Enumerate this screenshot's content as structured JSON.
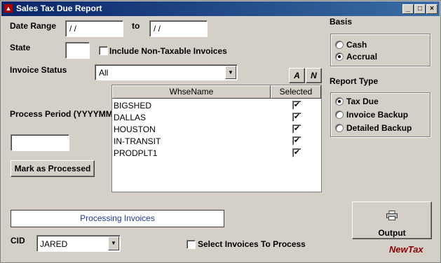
{
  "window": {
    "title": "Sales Tax Due Report",
    "icon": "report-app-icon"
  },
  "title_buttons": {
    "minimize": "_",
    "maximize": "□",
    "close": "×"
  },
  "filters": {
    "date_range_label": "Date Range",
    "date_from": "/ /",
    "to_label": "to",
    "date_to": "/ /",
    "state_label": "State",
    "state_value": "",
    "include_nontaxable_label": "Include Non-Taxable Invoices",
    "include_nontaxable_checked": false,
    "invoice_status_label": "Invoice Status",
    "invoice_status_value": "All"
  },
  "toolbar": {
    "all_button": "A",
    "none_button": "N"
  },
  "warehouse_grid": {
    "columns": [
      "WhseName",
      "Selected"
    ],
    "rows": [
      {
        "name": "BIGSHED",
        "selected": true
      },
      {
        "name": "DALLAS",
        "selected": true
      },
      {
        "name": "HOUSTON",
        "selected": true
      },
      {
        "name": "IN-TRANSIT",
        "selected": true
      },
      {
        "name": "PRODPLT1",
        "selected": true
      }
    ]
  },
  "process": {
    "period_label": "Process Period (YYYYMM)",
    "period_value": "",
    "mark_button": "Mark as Processed"
  },
  "status": {
    "text": "Processing Invoices"
  },
  "cid": {
    "label": "CID",
    "value": "JARED"
  },
  "select_invoices": {
    "label": "Select Invoices To Process",
    "checked": false
  },
  "basis": {
    "label": "Basis",
    "options": [
      {
        "label": "Cash",
        "selected": false
      },
      {
        "label": "Accrual",
        "selected": true
      }
    ]
  },
  "report_type": {
    "label": "Report Type",
    "options": [
      {
        "label": "Tax Due",
        "selected": true
      },
      {
        "label": "Invoice Backup",
        "selected": false
      },
      {
        "label": "Detailed Backup",
        "selected": false
      }
    ]
  },
  "output": {
    "label": "Output",
    "icon": "printer-icon"
  },
  "brand": {
    "text": "NewTax",
    "color": "#8b0000"
  }
}
